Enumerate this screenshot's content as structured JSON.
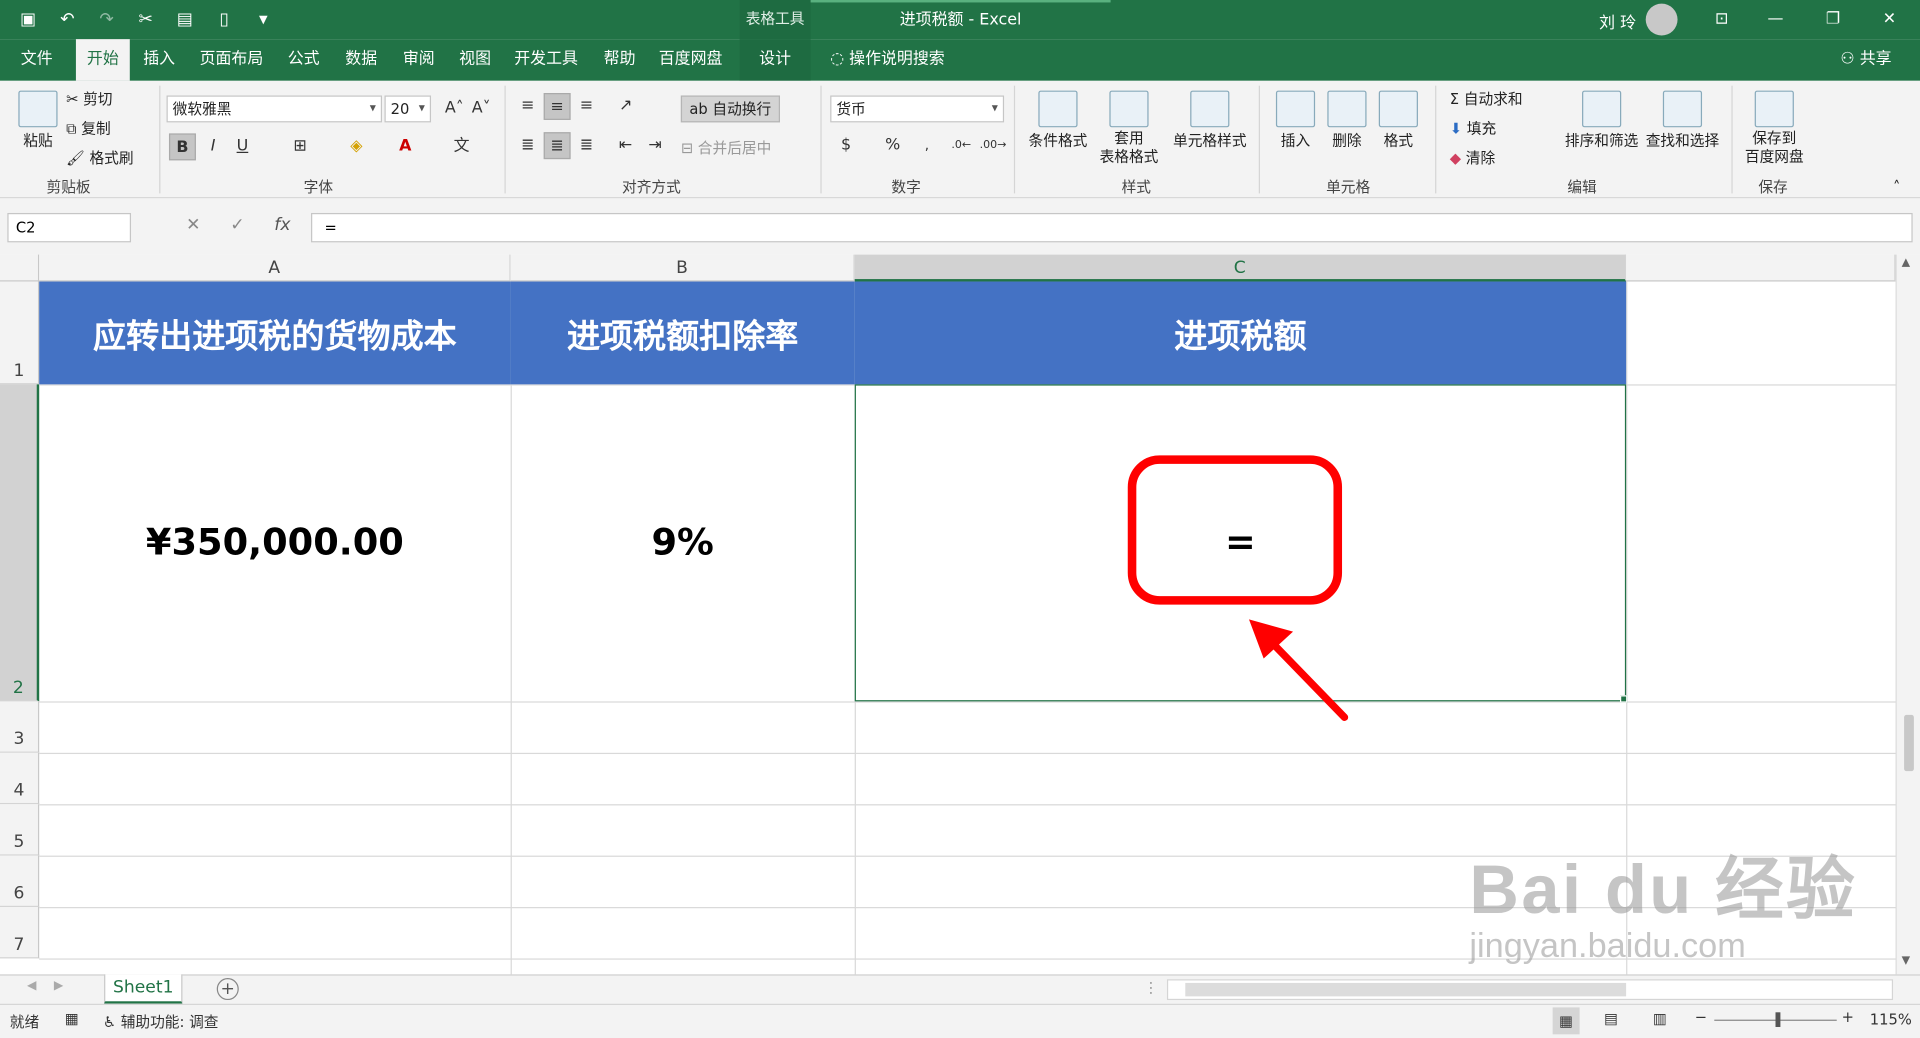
{
  "window": {
    "title": "进项税额 - Excel",
    "contextual_tab": "表格工具",
    "user_name": "刘 玲"
  },
  "tabs": [
    "文件",
    "开始",
    "插入",
    "页面布局",
    "公式",
    "数据",
    "审阅",
    "视图",
    "开发工具",
    "帮助",
    "百度网盘",
    "设计"
  ],
  "active_tab": "开始",
  "search_label": "操作说明搜索",
  "share_label": "共享",
  "ribbon": {
    "clipboard": {
      "paste": "粘贴",
      "cut": "剪切",
      "copy": "复制",
      "format_painter": "格式刷",
      "label": "剪贴板"
    },
    "font": {
      "name": "微软雅黑",
      "size": "20",
      "bold": "B",
      "italic": "I",
      "underline": "U",
      "label": "字体"
    },
    "alignment": {
      "wrap": "自动换行",
      "merge": "合并后居中",
      "label": "对齐方式"
    },
    "number": {
      "format": "货币",
      "percent": "%",
      "label": "数字"
    },
    "styles": {
      "conditional": "条件格式",
      "table_format_1": "套用",
      "table_format_2": "表格格式",
      "cell_styles": "单元格样式",
      "label": "样式"
    },
    "cells": {
      "insert": "插入",
      "delete": "删除",
      "format": "格式",
      "label": "单元格"
    },
    "editing": {
      "autosum": "自动求和",
      "fill": "填充",
      "clear": "清除",
      "sort": "排序和筛选",
      "find": "查找和选择",
      "label": "编辑"
    },
    "save": {
      "save_1": "保存到",
      "save_2": "百度网盘",
      "label": "保存"
    }
  },
  "formula_bar": {
    "name_box": "C2",
    "formula": "="
  },
  "columns": [
    "A",
    "B",
    "C"
  ],
  "rows": [
    "1",
    "2",
    "3",
    "4",
    "5",
    "6",
    "7"
  ],
  "table": {
    "headers": [
      "应转出进项税的货物成本",
      "进项税额扣除率",
      "进项税额"
    ],
    "values": [
      "¥350,000.00",
      "9%",
      "="
    ]
  },
  "sheet_tab": "Sheet1",
  "status": {
    "ready": "就绪",
    "accessibility": "辅助功能: 调查",
    "zoom": "115%"
  },
  "colors": {
    "excel_green": "#217346",
    "header_fill": "#4472c4",
    "highlight": "#ff0000"
  },
  "watermark": {
    "brand": "Bai du 经验",
    "url": "jingyan.baidu.com"
  }
}
